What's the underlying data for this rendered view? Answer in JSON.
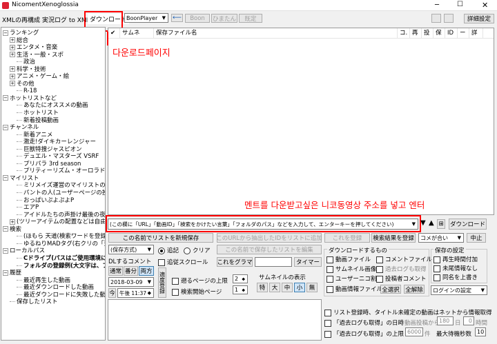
{
  "app": {
    "title": "NicomentXenoglossia"
  },
  "menu": {
    "items": [
      "XMLの再構成",
      "実況ログ to XML",
      "ダウンロード"
    ],
    "player": "BoonPlayer",
    "arrow_label": "⟵",
    "boon_label": "Boon",
    "himatan_label": "ひまたん",
    "kakutei_label": "既定",
    "detail_settings_label": "詳細設定"
  },
  "tree": [
    {
      "indent": 0,
      "toggle": "−",
      "label": "ランキング"
    },
    {
      "indent": 1,
      "toggle": "+",
      "label": "総合"
    },
    {
      "indent": 1,
      "toggle": "+",
      "label": "エンタメ・音楽"
    },
    {
      "indent": 1,
      "toggle": "+",
      "label": "生活・一般・スポ"
    },
    {
      "indent": 2,
      "toggle": "",
      "label": "政治"
    },
    {
      "indent": 1,
      "toggle": "+",
      "label": "科学・技術"
    },
    {
      "indent": 1,
      "toggle": "+",
      "label": "アニメ・ゲーム・絵"
    },
    {
      "indent": 1,
      "toggle": "+",
      "label": "その他"
    },
    {
      "indent": 2,
      "toggle": "",
      "label": "R-18"
    },
    {
      "indent": 0,
      "toggle": "−",
      "label": "ホットリストなど"
    },
    {
      "indent": 2,
      "toggle": "",
      "label": "あなたにオススメの動画"
    },
    {
      "indent": 2,
      "toggle": "",
      "label": "ホットリスト"
    },
    {
      "indent": 2,
      "toggle": "",
      "label": "新着投稿動画"
    },
    {
      "indent": 0,
      "toggle": "−",
      "label": "チャンネル"
    },
    {
      "indent": 2,
      "toggle": "",
      "label": "新着アニメ"
    },
    {
      "indent": 2,
      "toggle": "",
      "label": "激走!ダイキカーレンジャー"
    },
    {
      "indent": 2,
      "toggle": "",
      "label": "巨獣特捜ジャスピオン"
    },
    {
      "indent": 2,
      "toggle": "",
      "label": "デュエル・マスターズ VSRF"
    },
    {
      "indent": 2,
      "toggle": "",
      "label": "プリパラ 3rd season"
    },
    {
      "indent": 2,
      "toggle": "",
      "label": "プリティーリズム・オーロラドリーム"
    },
    {
      "indent": 0,
      "toggle": "−",
      "label": "マイリスト"
    },
    {
      "indent": 2,
      "toggle": "",
      "label": "ミリメイズ運営のマイリストの登録"
    },
    {
      "indent": 2,
      "toggle": "",
      "label": "パントの人(ユーザーページの投稿"
    },
    {
      "indent": 2,
      "toggle": "",
      "label": "おっぱいぷよぷよP"
    },
    {
      "indent": 2,
      "toggle": "",
      "label": "エアP"
    },
    {
      "indent": 2,
      "toggle": "",
      "label": "アイドルたちの声掛け最後の夜よ"
    },
    {
      "indent": 1,
      "toggle": "+",
      "label": "(ツリーアイテムの配置などは自由に"
    },
    {
      "indent": 0,
      "toggle": "−",
      "label": "検索"
    },
    {
      "indent": 2,
      "toggle": "",
      "label": "(ほもら 天道(検索ワードを登録し"
    },
    {
      "indent": 2,
      "toggle": "",
      "label": "ゆるねりMADタグ(右クリの「追加("
    },
    {
      "indent": 0,
      "toggle": "−",
      "label": "ローカルパス"
    },
    {
      "indent": 2,
      "toggle": "",
      "label": "Cドライブ(パスはご使用環境に",
      "bold": true
    },
    {
      "indent": 2,
      "toggle": "",
      "label": "フォルダの登録例(大文字は、フォ",
      "bold": true
    },
    {
      "indent": 0,
      "toggle": "−",
      "label": "履歴"
    },
    {
      "indent": 2,
      "toggle": "",
      "label": "最近再生した動画"
    },
    {
      "indent": 2,
      "toggle": "",
      "label": "最近ダウンロードした動画"
    },
    {
      "indent": 2,
      "toggle": "",
      "label": "最近ダウンロードに失敗した動画"
    },
    {
      "indent": 1,
      "toggle": "",
      "label": "保存したリスト"
    }
  ],
  "table": {
    "check_header": "✔",
    "columns": [
      "サムネ",
      "保存ファイル名",
      "コ.",
      "再",
      "投",
      "保",
      "ID",
      "ー",
      "詳"
    ]
  },
  "annotations": {
    "download_page": "다운로드페이지",
    "url_hint": "멘트를 다운받고싶은 니코동영상 주소를 넣고 엔터"
  },
  "url_bar": {
    "placeholder": "(この欄に「URL」「動画ID」「検索をかけたい言葉」「フォルダのパス」などを入力して、エンターキーを押してください)",
    "add_button": "⊞",
    "download_button": "ダウンロード"
  },
  "controls": {
    "save_list_btn": "この名前でリストを新規保存",
    "add_url_btn": "このURLから抽出したIDをリストに追加",
    "overwrite_btn": "この名前で保存したリストを編集",
    "delete_btn": "これを登録",
    "register_search_btn": "検索結果を登録",
    "comment_select": "コメが合い",
    "stop_btn": "中止",
    "save_dest": "(保存方式)",
    "append_label": "追記",
    "clear_label": "クリア",
    "dl_comment_label": "DLするコメント",
    "normal_label": "通常",
    "backup_label": "番分",
    "both_label": "両方",
    "append_scroll_label": "追従スクロール",
    "date": "2018-03-09",
    "now_label": "今",
    "time": "午後 11:37",
    "register_label": "適度登録",
    "nearest_page_label": "遡るページの上限",
    "nearest_page_value": "2",
    "search_start_label": "検索開始ページ",
    "search_start_value": "1",
    "is_gramma_label": "これをグラマ",
    "timer_label": "タイマー",
    "thumb_display_label": "サムネイルの表示",
    "thumb_sizes": [
      "特",
      "大",
      "中",
      "小",
      "無"
    ],
    "thumb_selected": "小",
    "download_items_title": "ダウンロードするもの",
    "dl_items": [
      "動画ファイル",
      "コメントファイル",
      "サムネイル画像",
      "過去ログも取得",
      "ユーザーニコ割",
      "投稿者コメント",
      "動画情報ファイル"
    ],
    "select_all_btn": "全選択",
    "deselect_all_btn": "全解除",
    "save_settings_title": "保存の設定",
    "save_opts": [
      "再生時間付加",
      "未尾情報なし",
      "同名を上書き"
    ],
    "login_settings": "ログインの設定",
    "list_register_label": "リスト登録時、タイトル未確定の動画はネットから情報取得",
    "past_log_label": "「過去ログも取得」の日時",
    "past_log_from": "動画投稿から",
    "past_log_days": "180",
    "past_log_day_unit": "日",
    "past_log_hours": "0",
    "past_log_hour_unit": "時間",
    "past_log_limit_label": "「過去ログも取得」の上限",
    "past_log_limit_value": "6000",
    "past_log_limit_unit": "件",
    "max_wait_label": "最大待機秒数",
    "max_wait_value": "10"
  }
}
